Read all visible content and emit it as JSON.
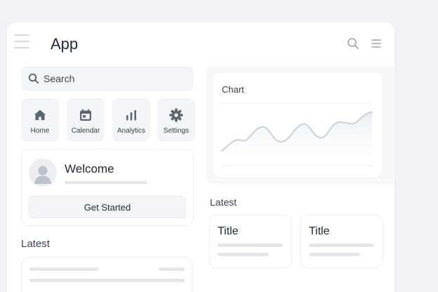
{
  "header": {
    "menu_icon": "hamburger-icon",
    "title": "App",
    "search_icon": "search-icon",
    "menu_right_icon": "menu-icon"
  },
  "search": {
    "placeholder": "Search",
    "icon": "search-icon"
  },
  "nav": {
    "items": [
      {
        "label": "Home",
        "icon": "home-icon"
      },
      {
        "label": "Calendar",
        "icon": "calendar-icon"
      },
      {
        "label": "Analytics",
        "icon": "bar-chart-icon"
      },
      {
        "label": "Settings",
        "icon": "gear-icon"
      }
    ]
  },
  "welcome": {
    "title": "Welcome",
    "button_label": "Get Started",
    "avatar_icon": "user-avatar-icon"
  },
  "chart": {
    "title": "Chart"
  },
  "latest_left": {
    "heading": "Latest"
  },
  "latest_right": {
    "heading": "Latest",
    "cards": [
      {
        "title": "Title"
      },
      {
        "title": "Title"
      }
    ]
  },
  "colors": {
    "background": "#f1f2f5",
    "card": "#ffffff",
    "muted_fill": "#f3f5f8",
    "icon": "#5c6775",
    "chart_line": "#c8d1dd"
  }
}
